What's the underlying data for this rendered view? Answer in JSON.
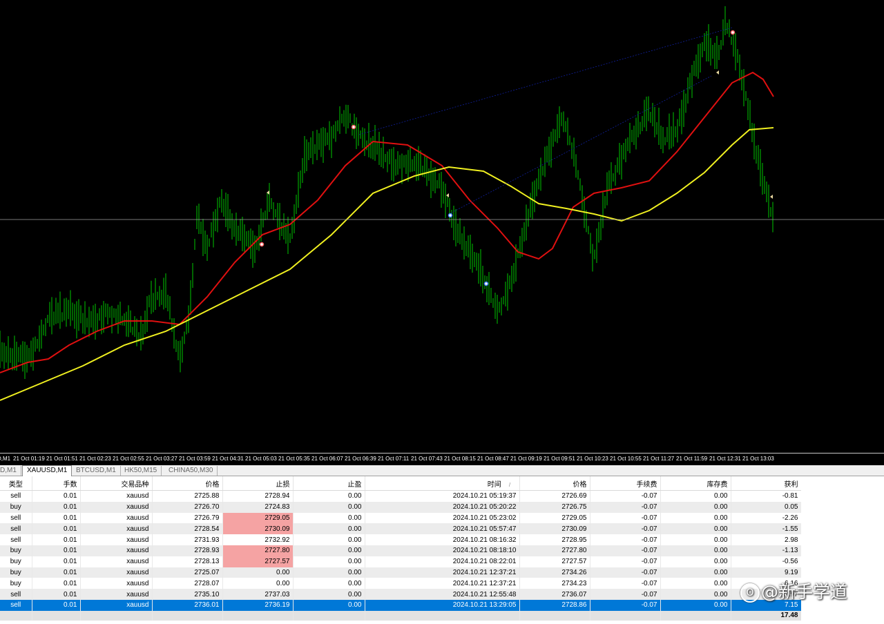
{
  "chart": {
    "colors": {
      "background": "#000000",
      "candles": "#00c800",
      "ma_fast": "#e01010",
      "ma_slow": "#f0f020",
      "hline": "#a0a0a0",
      "trend": "#1020a0"
    },
    "time_labels": [
      "D,M1",
      "21 Oct 01:19",
      "21 Oct 01:51",
      "21 Oct 02:23",
      "21 Oct 02:55",
      "21 Oct 03:27",
      "21 Oct 03:59",
      "21 Oct 04:31",
      "21 Oct 05:03",
      "21 Oct 05:35",
      "21 Oct 06:07",
      "21 Oct 06:39",
      "21 Oct 07:11",
      "21 Oct 07:43",
      "21 Oct 08:15",
      "21 Oct 08:47",
      "21 Oct 09:19",
      "21 Oct 09:51",
      "21 Oct 10:23",
      "21 Oct 10:55",
      "21 Oct 11:27",
      "21 Oct 11:59",
      "21 Oct 12:31",
      "21 Oct 13:03"
    ]
  },
  "tabs": [
    {
      "label": "D,M1",
      "active": false
    },
    {
      "label": "XAUUSD,M1",
      "active": true
    },
    {
      "label": "BTCUSD,M1",
      "active": false
    },
    {
      "label": "HK50,M15",
      "active": false
    },
    {
      "label": "CHINA50,M30",
      "active": false
    }
  ],
  "table": {
    "headers": [
      "类型",
      "手数",
      "交易品种",
      "价格",
      "止损",
      "止盈",
      "时间",
      "价格",
      "手续费",
      "库存费",
      "获利"
    ],
    "sort_indicator": "/",
    "rows": [
      {
        "type": "sell",
        "lots": "0.01",
        "symbol": "xauusd",
        "price": "2725.88",
        "sl": "2728.94",
        "tp": "0.00",
        "time": "2024.10.21 05:19:37",
        "close_price": "2726.69",
        "commission": "-0.07",
        "swap": "0.00",
        "profit": "-0.81",
        "sl_hit": false
      },
      {
        "type": "buy",
        "lots": "0.01",
        "symbol": "xauusd",
        "price": "2726.70",
        "sl": "2724.83",
        "tp": "0.00",
        "time": "2024.10.21 05:20:22",
        "close_price": "2726.75",
        "commission": "-0.07",
        "swap": "0.00",
        "profit": "0.05",
        "sl_hit": false
      },
      {
        "type": "sell",
        "lots": "0.01",
        "symbol": "xauusd",
        "price": "2726.79",
        "sl": "2729.05",
        "tp": "0.00",
        "time": "2024.10.21 05:23:02",
        "close_price": "2729.05",
        "commission": "-0.07",
        "swap": "0.00",
        "profit": "-2.26",
        "sl_hit": true
      },
      {
        "type": "sell",
        "lots": "0.01",
        "symbol": "xauusd",
        "price": "2728.54",
        "sl": "2730.09",
        "tp": "0.00",
        "time": "2024.10.21 05:57:47",
        "close_price": "2730.09",
        "commission": "-0.07",
        "swap": "0.00",
        "profit": "-1.55",
        "sl_hit": true
      },
      {
        "type": "sell",
        "lots": "0.01",
        "symbol": "xauusd",
        "price": "2731.93",
        "sl": "2732.92",
        "tp": "0.00",
        "time": "2024.10.21 08:16:32",
        "close_price": "2728.95",
        "commission": "-0.07",
        "swap": "0.00",
        "profit": "2.98",
        "sl_hit": false
      },
      {
        "type": "buy",
        "lots": "0.01",
        "symbol": "xauusd",
        "price": "2728.93",
        "sl": "2727.80",
        "tp": "0.00",
        "time": "2024.10.21 08:18:10",
        "close_price": "2727.80",
        "commission": "-0.07",
        "swap": "0.00",
        "profit": "-1.13",
        "sl_hit": true
      },
      {
        "type": "buy",
        "lots": "0.01",
        "symbol": "xauusd",
        "price": "2728.13",
        "sl": "2727.57",
        "tp": "0.00",
        "time": "2024.10.21 08:22:01",
        "close_price": "2727.57",
        "commission": "-0.07",
        "swap": "0.00",
        "profit": "-0.56",
        "sl_hit": true
      },
      {
        "type": "buy",
        "lots": "0.01",
        "symbol": "xauusd",
        "price": "2725.07",
        "sl": "0.00",
        "tp": "0.00",
        "time": "2024.10.21 12:37:21",
        "close_price": "2734.26",
        "commission": "-0.07",
        "swap": "0.00",
        "profit": "9.19",
        "sl_hit": false
      },
      {
        "type": "buy",
        "lots": "0.01",
        "symbol": "xauusd",
        "price": "2728.07",
        "sl": "0.00",
        "tp": "0.00",
        "time": "2024.10.21 12:37:21",
        "close_price": "2734.23",
        "commission": "-0.07",
        "swap": "0.00",
        "profit": "6.16",
        "sl_hit": false
      },
      {
        "type": "sell",
        "lots": "0.01",
        "symbol": "xauusd",
        "price": "2735.10",
        "sl": "2737.03",
        "tp": "0.00",
        "time": "2024.10.21 12:55:48",
        "close_price": "2736.07",
        "commission": "-0.07",
        "swap": "0.00",
        "profit": "-0.97",
        "sl_hit": false
      },
      {
        "type": "sell",
        "lots": "0.01",
        "symbol": "xauusd",
        "price": "2736.01",
        "sl": "2736.19",
        "tp": "0.00",
        "time": "2024.10.21 13:29:05",
        "close_price": "2728.86",
        "commission": "-0.07",
        "swap": "0.00",
        "profit": "7.15",
        "sl_hit": false,
        "selected": true
      }
    ],
    "total_profit": "17.48"
  },
  "watermark": {
    "text": "@新手学道",
    "icon": "weibo-icon"
  }
}
